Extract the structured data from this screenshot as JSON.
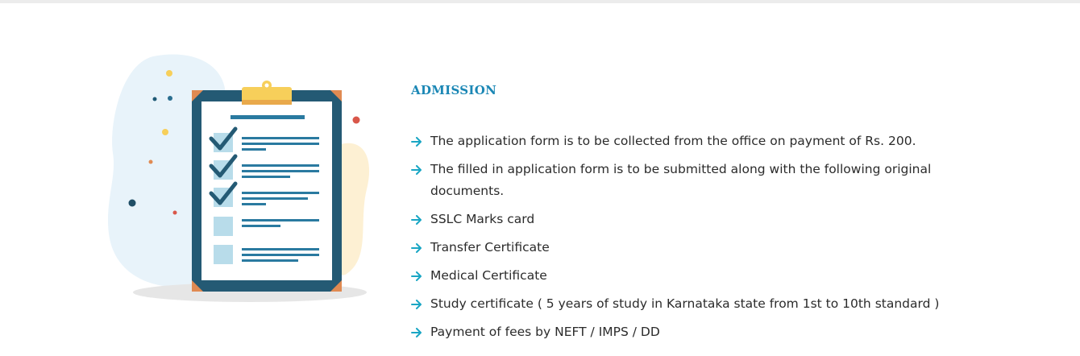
{
  "section": {
    "title": "ADMISSION"
  },
  "items": [
    "The application form is to be collected from the office on payment of Rs. 200.",
    "The filled in application form is to be submitted along with the following original documents.",
    "SSLC Marks card",
    "Transfer Certificate",
    "Medical Certificate",
    "Study certificate ( 5 years of study in Karnataka state from 1st to 10th standard )",
    "Payment of fees by NEFT / IMPS / DD"
  ],
  "icons": {
    "bullet": "arrow-right-icon",
    "illustration": "clipboard-checklist-icon"
  },
  "colors": {
    "accent": "#1b87b5",
    "bullet": "#1aa6c4",
    "text": "#2b2b2b",
    "clipboard": "#245a74"
  }
}
